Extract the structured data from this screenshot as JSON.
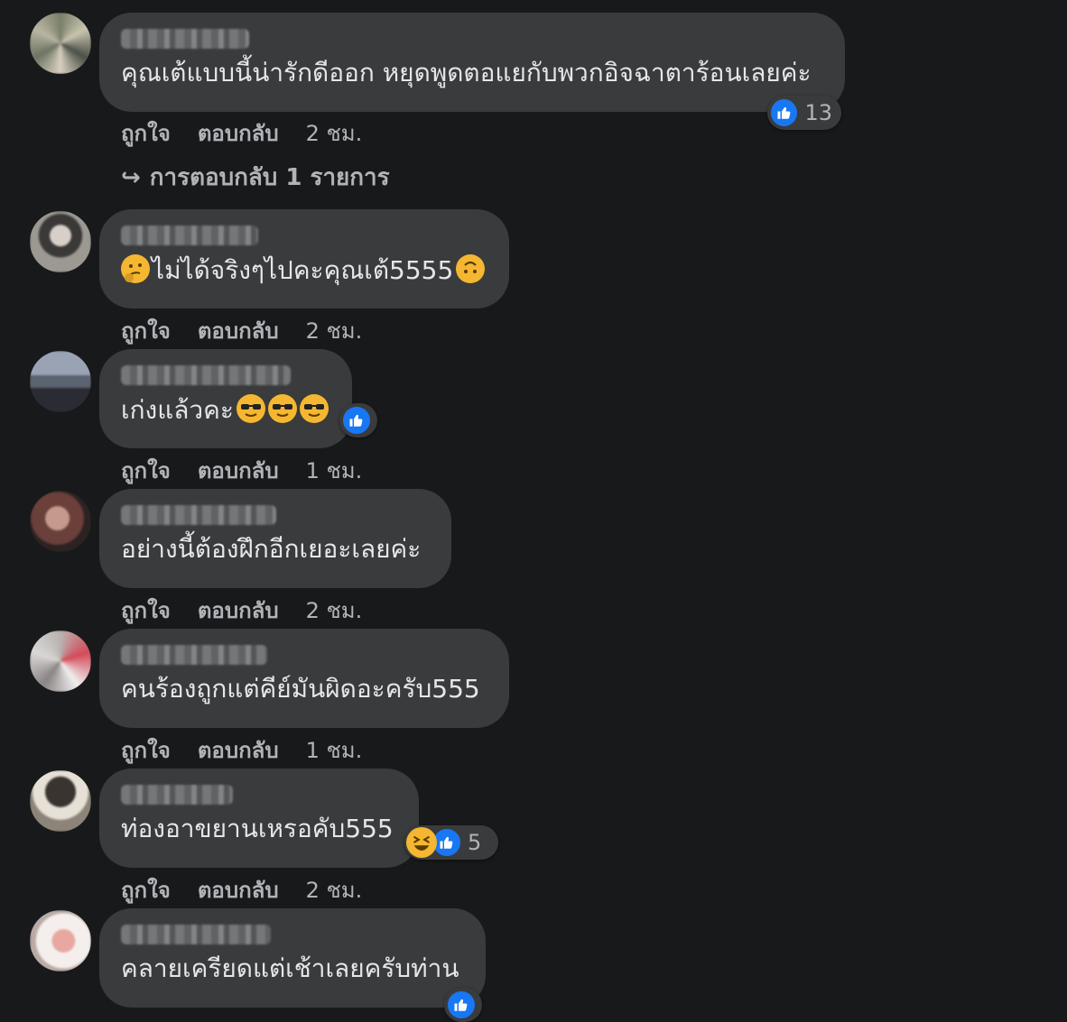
{
  "actions": {
    "like": "ถูกใจ",
    "reply": "ตอบกลับ"
  },
  "replies_link": "การตอบกลับ 1 รายการ",
  "colors": {
    "background": "#18191a",
    "bubble": "#3a3b3c",
    "like": "#1877f2",
    "muted": "#b0b3b8"
  },
  "comments": [
    {
      "text": "คุณเต้แบบนี้น่ารักดีออก หยุดพูดตอแยกับพวกอิจฉาตาร้อนเลยค่ะ",
      "time": "2 ชม.",
      "reaction_count": "13",
      "emojis_prefix": [],
      "emojis_suffix": []
    },
    {
      "text": "ไม่ได้จริงๆไปคะคุณเต้5555",
      "time": "2 ชม.",
      "reaction_count": "",
      "emojis_prefix": [
        "thinking-face"
      ],
      "emojis_suffix": [
        "upside-down-face"
      ]
    },
    {
      "text": "เก่งแล้วคะ",
      "time": "1 ชม.",
      "reaction_count": "",
      "emojis_prefix": [],
      "emojis_suffix": [
        "sunglasses-face",
        "sunglasses-face",
        "sunglasses-face"
      ]
    },
    {
      "text": "อย่างนี้ต้องฝึกอีกเยอะเลยค่ะ",
      "time": "2 ชม.",
      "reaction_count": "",
      "emojis_prefix": [],
      "emojis_suffix": []
    },
    {
      "text": "คนร้องถูกแต่คีย์มันผิดอะครับ555",
      "time": "1 ชม.",
      "reaction_count": "",
      "emojis_prefix": [],
      "emojis_suffix": []
    },
    {
      "text": "ท่องอาขยานเหรอคับ555",
      "time": "2 ชม.",
      "reaction_count": "5",
      "emojis_prefix": [],
      "emojis_suffix": []
    },
    {
      "text": "คลายเครียดแต่เช้าเลยครับท่าน",
      "time": "",
      "reaction_count": "",
      "emojis_prefix": [],
      "emojis_suffix": []
    }
  ]
}
